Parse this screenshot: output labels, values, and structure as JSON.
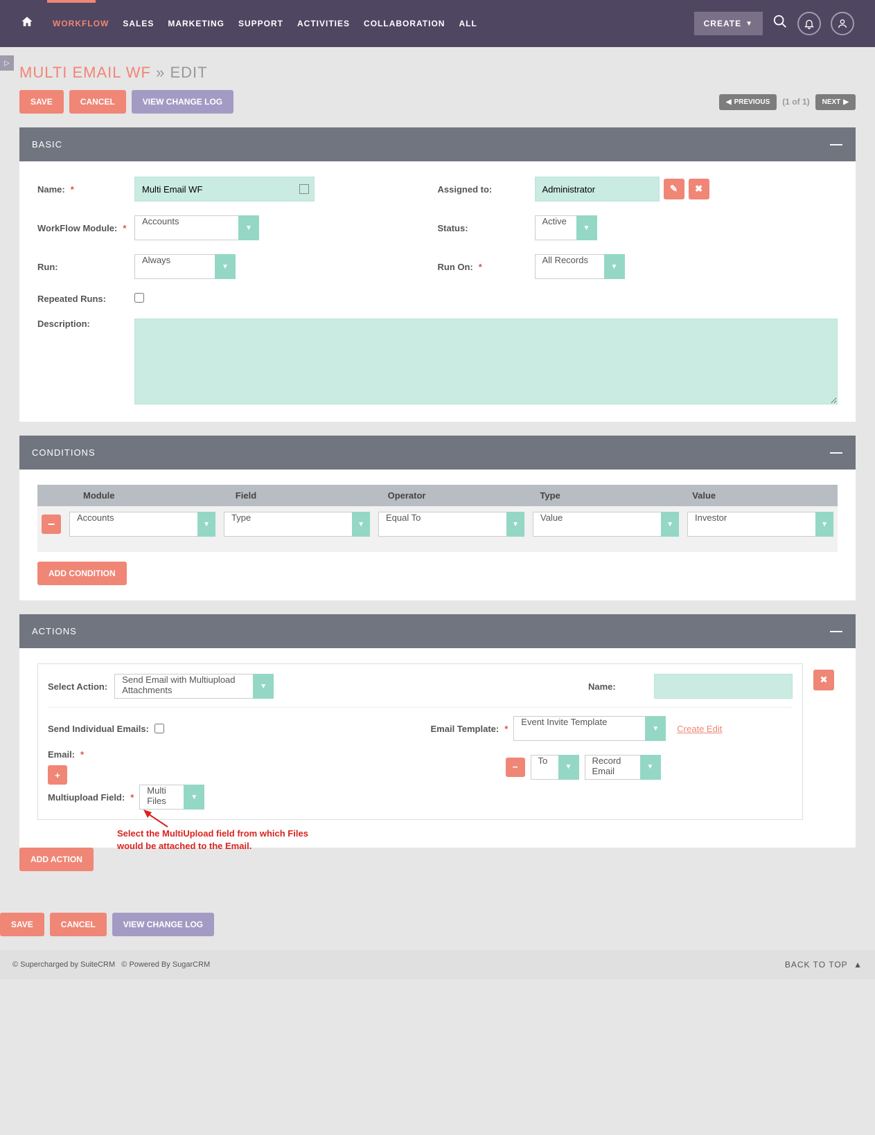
{
  "nav": {
    "items": [
      "WORKFLOW",
      "SALES",
      "MARKETING",
      "SUPPORT",
      "ACTIVITIES",
      "COLLABORATION",
      "ALL"
    ],
    "active": "WORKFLOW",
    "create": "CREATE"
  },
  "page": {
    "title_main": "MULTI EMAIL WF",
    "title_sep": "»",
    "title_sub": "EDIT",
    "save": "SAVE",
    "cancel": "CANCEL",
    "view_log": "VIEW CHANGE LOG",
    "prev": "PREVIOUS",
    "next": "NEXT",
    "page_info": "(1 of 1)"
  },
  "panels": {
    "basic": "BASIC",
    "conditions": "CONDITIONS",
    "actions": "ACTIONS"
  },
  "basic": {
    "name_lbl": "Name:",
    "name_val": "Multi Email WF",
    "assigned_lbl": "Assigned to:",
    "assigned_val": "Administrator",
    "module_lbl": "WorkFlow Module:",
    "module_val": "Accounts",
    "status_lbl": "Status:",
    "status_val": "Active",
    "run_lbl": "Run:",
    "run_val": "Always",
    "runon_lbl": "Run On:",
    "runon_val": "All Records",
    "repeat_lbl": "Repeated Runs:",
    "desc_lbl": "Description:"
  },
  "conditions": {
    "headers": {
      "module": "Module",
      "field": "Field",
      "operator": "Operator",
      "type": "Type",
      "value": "Value"
    },
    "row": {
      "module": "Accounts",
      "field": "Type",
      "operator": "Equal To",
      "type": "Value",
      "value": "Investor"
    },
    "add": "ADD CONDITION"
  },
  "actions": {
    "select_lbl": "Select Action:",
    "select_val": "Send Email with Multiupload Attachments",
    "name_lbl": "Name:",
    "name_val": "",
    "send_ind_lbl": "Send Individual Emails:",
    "tmpl_lbl": "Email Template:",
    "tmpl_val": "Event Invite Template",
    "create_edit": "Create Edit",
    "email_lbl": "Email:",
    "multi_lbl": "Multiupload Field:",
    "multi_val": "Multi Files",
    "to_val": "To",
    "rec_email_val": "Record Email",
    "add": "ADD ACTION",
    "annotation": "Select the MultiUpload field from which Files would be attached to the Email."
  },
  "footer": {
    "left1": "© Supercharged by SuiteCRM",
    "left2": "© Powered By SugarCRM",
    "backtop": "BACK TO TOP"
  }
}
